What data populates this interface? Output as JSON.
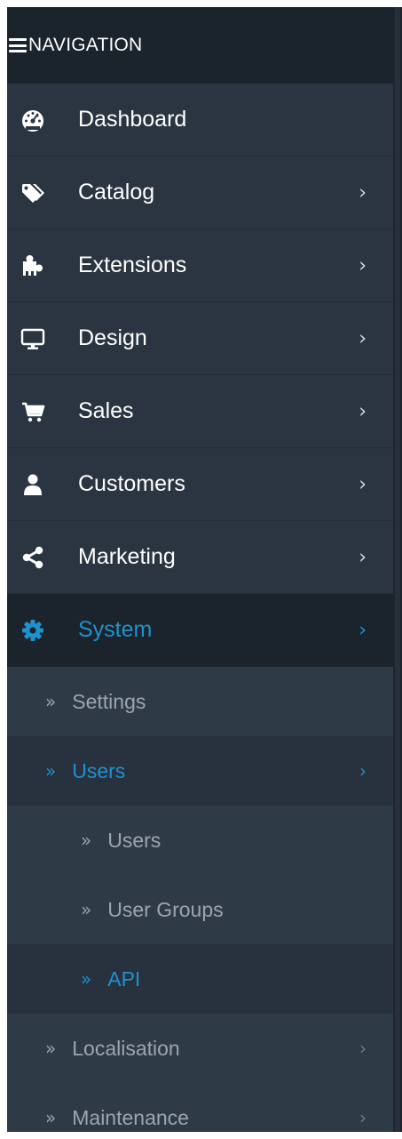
{
  "header": {
    "title": "NAVIGATION",
    "icon": "menu-icon"
  },
  "menu": {
    "dashboard": {
      "label": "Dashboard",
      "icon": "dashboard-gauge-icon"
    },
    "catalog": {
      "label": "Catalog",
      "icon": "tags-icon",
      "chevron": "›"
    },
    "extensions": {
      "label": "Extensions",
      "icon": "puzzle-icon",
      "chevron": "›"
    },
    "design": {
      "label": "Design",
      "icon": "monitor-icon",
      "chevron": "›"
    },
    "sales": {
      "label": "Sales",
      "icon": "shopping-cart-icon",
      "chevron": "›"
    },
    "customers": {
      "label": "Customers",
      "icon": "user-icon",
      "chevron": "›"
    },
    "marketing": {
      "label": "Marketing",
      "icon": "share-icon",
      "chevron": "›"
    },
    "system": {
      "label": "System",
      "icon": "cog-icon",
      "chevron": "›",
      "active": true
    }
  },
  "system_submenu": {
    "bullet": "»",
    "settings": {
      "label": "Settings"
    },
    "users": {
      "label": "Users",
      "chevron": "›",
      "open": true,
      "children": {
        "users": {
          "label": "Users"
        },
        "user_groups": {
          "label": "User Groups"
        },
        "api": {
          "label": "API",
          "current": true
        }
      }
    },
    "localisation": {
      "label": "Localisation",
      "chevron": "›"
    },
    "maintenance": {
      "label": "Maintenance",
      "chevron": "›"
    }
  },
  "colors": {
    "sidebar_bg": "#2b3541",
    "header_bg": "#1b232d",
    "active_bg": "#1b232d",
    "accent": "#1e91cf",
    "submenu_bg": "#2f3a47",
    "submenu_text": "#9aa5b1"
  }
}
